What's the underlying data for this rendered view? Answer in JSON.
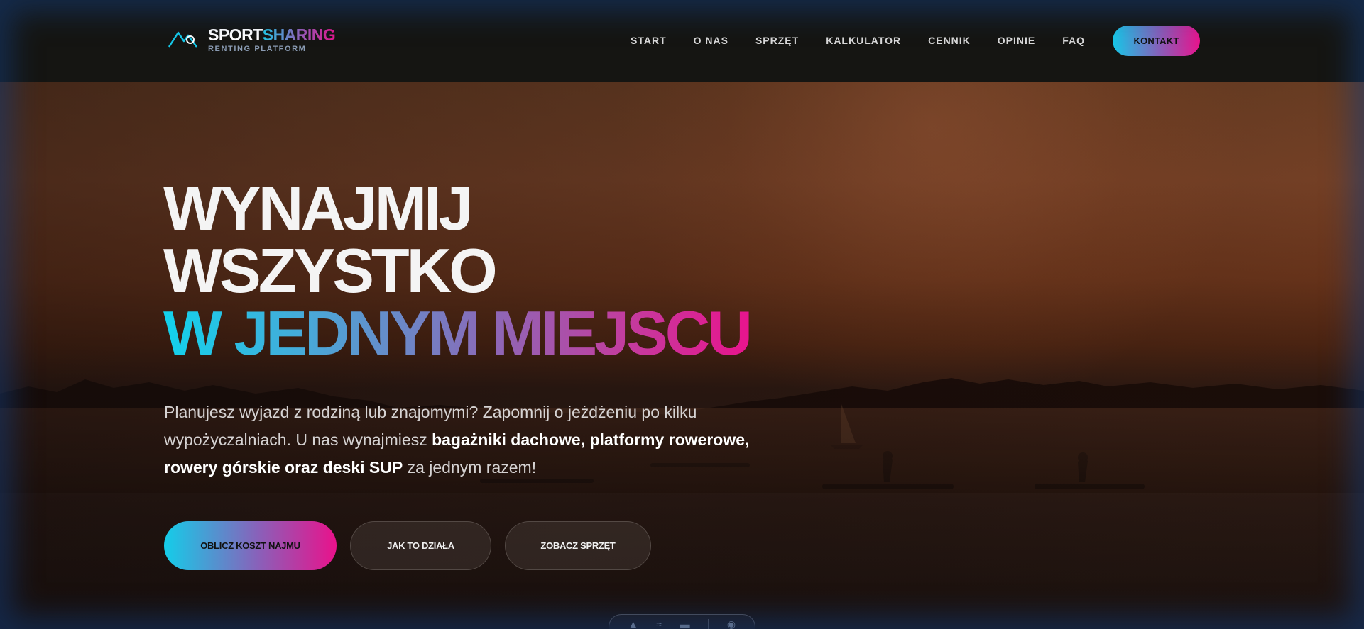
{
  "brand": {
    "name_part1": "SPORT",
    "name_part2": "SHARING",
    "tagline": "RENTING PLATFORM",
    "logo_icon": "mountain-logo-icon"
  },
  "nav": {
    "items": [
      {
        "label": "START"
      },
      {
        "label": "O NAS"
      },
      {
        "label": "SPRZĘT"
      },
      {
        "label": "KALKULATOR"
      },
      {
        "label": "CENNIK"
      },
      {
        "label": "OPINIE"
      },
      {
        "label": "FAQ"
      }
    ],
    "contact_label": "KONTAKT"
  },
  "hero": {
    "title_line1": "WYNAJMIJ",
    "title_line2": "WSZYSTKO",
    "title_line3": "W JEDNYM MIEJSCU",
    "lead_part1": "Planujesz wyjazd z rodziną lub znajomymi? Zapomnij o jeżdżeniu po kilku wypożyczalniach. U nas wynajmiesz ",
    "lead_bold": "bagażniki dachowe, platformy rowerowe, rowery górskie oraz deski SUP",
    "lead_part2": " za jednym razem!",
    "buttons": {
      "primary": "OBLICZ KOSZT NAJMU",
      "secondary": "JAK TO DZIAŁA",
      "tertiary": "ZOBACZ SPRZĘT"
    }
  },
  "tray": {
    "icons": [
      "bike-rack-icon",
      "sup-icon",
      "roof-box-icon",
      "mountain-bike-icon"
    ]
  },
  "colors": {
    "accent_cyan": "#16c8e8",
    "accent_purple": "#8a5cb8",
    "accent_pink": "#e8148d",
    "header_bg": "#151512"
  }
}
